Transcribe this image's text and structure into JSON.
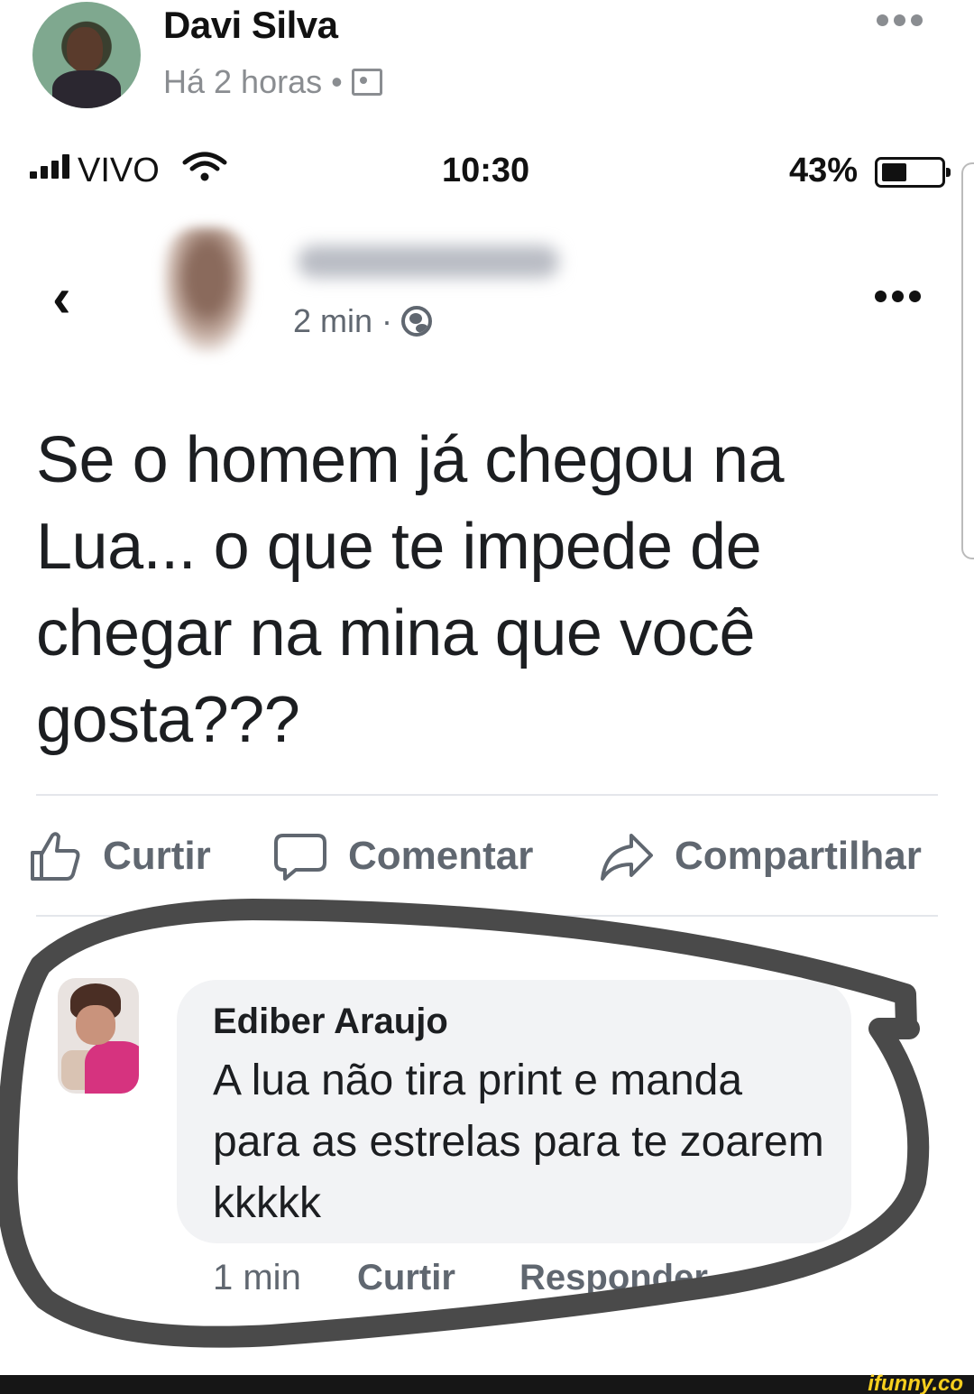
{
  "outer_post": {
    "author": "Davi Silva",
    "time": "Há 2 horas",
    "separator": "•",
    "privacy_icon": "photo-icon",
    "more_icon": "more-dots-icon"
  },
  "status_bar": {
    "carrier": "VIVO",
    "time": "10:30",
    "battery": "43%",
    "battery_level": 0.43
  },
  "inner_post": {
    "time": "2 min",
    "separator": "·",
    "privacy_icon": "globe-icon",
    "text": "Se o homem já chegou na Lua... o que te impede de chegar na mina que você gosta???"
  },
  "actions": {
    "like": "Curtir",
    "comment": "Comentar",
    "share": "Compartilhar"
  },
  "comment": {
    "author": "Ediber Araujo",
    "text": "A lua não tira print e manda para as estrelas para te zoarem kkkkk",
    "time": "1 min",
    "like": "Curtir",
    "reply": "Responder"
  },
  "watermark": "ifunny.co",
  "colors": {
    "text": "#1c1e21",
    "secondary": "#606770",
    "bubble": "#f2f3f5",
    "marker": "#4a4a4a",
    "watermark": "#f7cf1e"
  }
}
